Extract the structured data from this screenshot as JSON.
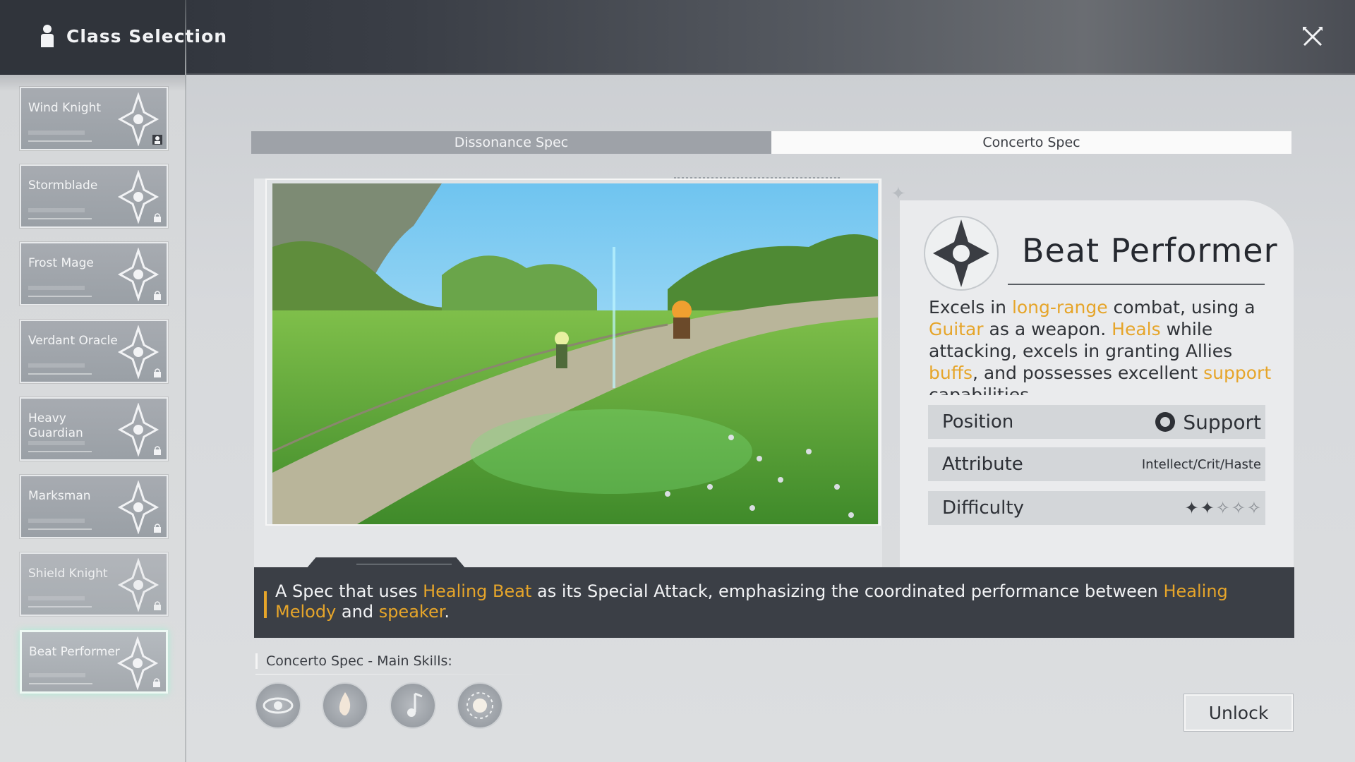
{
  "header": {
    "title": "Class Selection"
  },
  "classes": [
    {
      "name": "Wind Knight",
      "emblem": "wind-knight-emblem",
      "badge": "person-badge"
    },
    {
      "name": "Stormblade",
      "emblem": "stormblade-emblem",
      "badge": "lock"
    },
    {
      "name": "Frost Mage",
      "emblem": "frost-mage-emblem",
      "badge": "lock"
    },
    {
      "name": "Verdant Oracle",
      "emblem": "verdant-oracle-emblem",
      "badge": "lock"
    },
    {
      "name": "Heavy Guardian",
      "emblem": "heavy-guardian-emblem",
      "badge": "lock"
    },
    {
      "name": "Marksman",
      "emblem": "marksman-emblem",
      "badge": "lock"
    },
    {
      "name": "Shield Knight",
      "emblem": "shield-knight-emblem",
      "badge": "lock"
    },
    {
      "name": "Beat Performer",
      "emblem": "beat-performer-emblem",
      "badge": "lock",
      "selected": true
    }
  ],
  "tabs": [
    {
      "label": "Dissonance Spec",
      "active": false
    },
    {
      "label": "Concerto Spec",
      "active": true
    }
  ],
  "spec": {
    "name": "Beat Performer",
    "description_parts": [
      {
        "t": "Excels in ",
        "hl": false
      },
      {
        "t": "long-range",
        "hl": true
      },
      {
        "t": " combat, using a ",
        "hl": false
      },
      {
        "t": "Guitar",
        "hl": true
      },
      {
        "t": " as a weapon. ",
        "hl": false
      },
      {
        "t": "Heals",
        "hl": true
      },
      {
        "t": " while attacking, excels in granting Allies ",
        "hl": false
      },
      {
        "t": "buffs",
        "hl": true
      },
      {
        "t": ", and possesses excellent ",
        "hl": false
      },
      {
        "t": "support",
        "hl": true
      },
      {
        "t": " capabilities",
        "hl": false
      }
    ],
    "stats": {
      "position_label": "Position",
      "position_value": "Support",
      "attribute_label": "Attribute",
      "attribute_value": "Intellect/Crit/Haste",
      "difficulty_label": "Difficulty",
      "difficulty_rating": 2,
      "difficulty_max": 5
    }
  },
  "spec_summary_parts": [
    {
      "t": "A Spec that uses ",
      "hl": false
    },
    {
      "t": "Healing Beat",
      "hl": true
    },
    {
      "t": " as its Special Attack, emphasizing the coordinated performance between ",
      "hl": false
    },
    {
      "t": "Healing Melody",
      "hl": true
    },
    {
      "t": " and ",
      "hl": false
    },
    {
      "t": "speaker",
      "hl": true
    },
    {
      "t": ".",
      "hl": false
    }
  ],
  "skills": {
    "label": "Concerto Spec - Main Skills:",
    "icons": [
      "swirl-skill-icon",
      "flame-skill-icon",
      "note-skill-icon",
      "burst-skill-icon"
    ]
  },
  "unlock_label": "Unlock",
  "colors": {
    "highlight": "#e6a52a",
    "band": "#3b3f46"
  }
}
